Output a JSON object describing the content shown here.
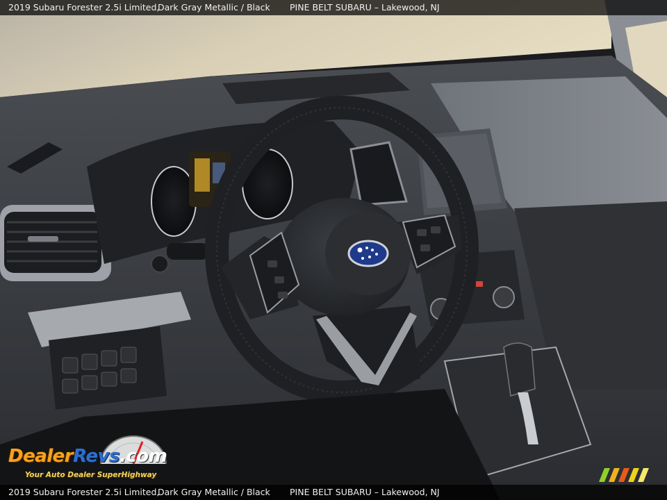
{
  "caption": {
    "vehicle": "2019 Subaru Forester 2.5i Limited,",
    "colors": "Dark Gray Metallic / Black",
    "dealer": "PINE BELT SUBARU – Lakewood, NJ"
  },
  "watermark": {
    "brand_dealer": "Dealer",
    "brand_revs": "Revs",
    "brand_com": ".com",
    "tagline": "Your Auto Dealer SuperHighway"
  },
  "photo": {
    "subject": "steering-wheel-dashboard",
    "palette": {
      "dash": "#2a2c30",
      "dash_light": "#6b6f75",
      "trim": "#b9bcc0",
      "windshield": "#d8d0bd",
      "logo_blue": "#1f3a8a"
    }
  }
}
